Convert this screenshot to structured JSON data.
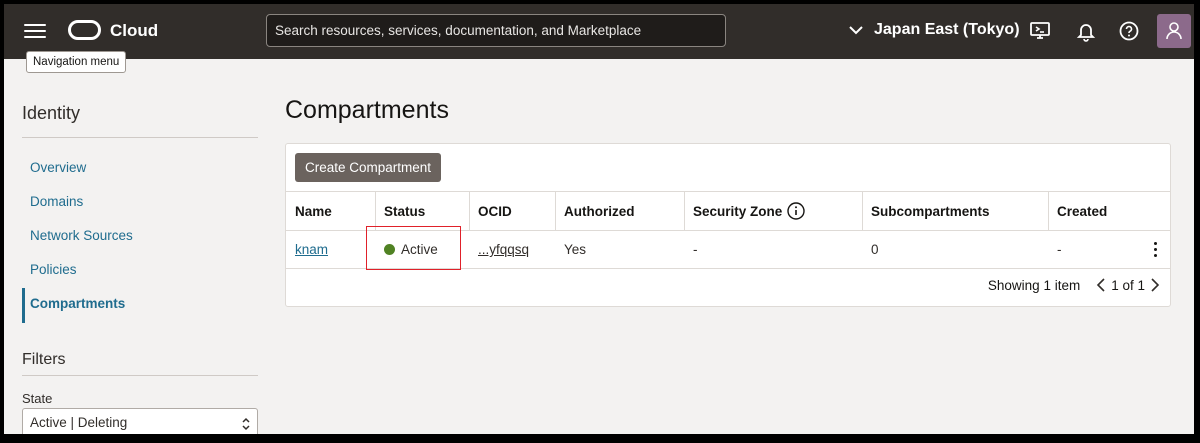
{
  "header": {
    "brand": "Cloud",
    "search_placeholder": "Search resources, services, documentation, and Marketplace",
    "region": "Japan East (Tokyo)",
    "tooltip": "Navigation menu"
  },
  "sidebar": {
    "title": "Identity",
    "items": [
      {
        "label": "Overview"
      },
      {
        "label": "Domains"
      },
      {
        "label": "Network Sources"
      },
      {
        "label": "Policies"
      },
      {
        "label": "Compartments",
        "active": true
      }
    ],
    "filters_title": "Filters",
    "state_label": "State",
    "state_value": "Active | Deleting"
  },
  "main": {
    "title": "Compartments",
    "create_button": "Create Compartment",
    "columns": [
      "Name",
      "Status",
      "OCID",
      "Authorized",
      "Security Zone",
      "Subcompartments",
      "Created"
    ],
    "rows": [
      {
        "name": "knam",
        "status": "Active",
        "ocid": "...yfqqsq",
        "authorized": "Yes",
        "security_zone": "-",
        "subcompartments": "0",
        "created": "-"
      }
    ],
    "showing": "Showing 1 item",
    "page": "1 of 1"
  },
  "colors": {
    "header_bg": "#312d2a",
    "link": "#1f6c8e",
    "status_active": "#508223",
    "highlight": "#e0212a"
  }
}
